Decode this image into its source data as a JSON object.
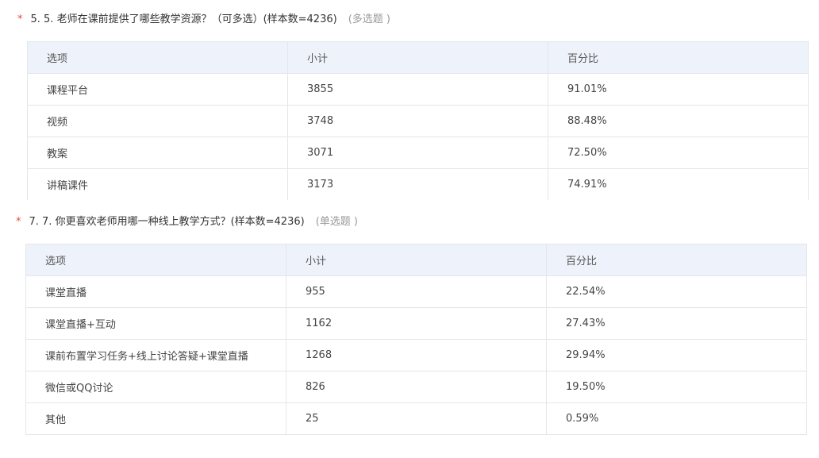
{
  "questions": [
    {
      "required_mark": "*",
      "title": "5. 5. 老师在课前提供了哪些教学资源？（可多选）(样本数=4236)",
      "type_label": "(多选题 )",
      "columns": [
        "选项",
        "小计",
        "百分比"
      ],
      "rows": [
        {
          "option": "课程平台",
          "count": "3855",
          "percent": "91.01%"
        },
        {
          "option": "视频",
          "count": "3748",
          "percent": "88.48%"
        },
        {
          "option": "教案",
          "count": "3071",
          "percent": "72.50%"
        },
        {
          "option": "讲稿课件",
          "count": "3173",
          "percent": "74.91%"
        }
      ]
    },
    {
      "required_mark": "*",
      "title": "7. 7. 你更喜欢老师用哪一种线上教学方式？(样本数=4236)",
      "type_label": "(单选题 )",
      "columns": [
        "选项",
        "小计",
        "百分比"
      ],
      "rows": [
        {
          "option": "课堂直播",
          "count": "955",
          "percent": "22.54%"
        },
        {
          "option": "课堂直播+互动",
          "count": "1162",
          "percent": "27.43%"
        },
        {
          "option": "课前布置学习任务+线上讨论答疑+课堂直播",
          "count": "1268",
          "percent": "29.94%"
        },
        {
          "option": "微信或QQ讨论",
          "count": "826",
          "percent": "19.50%"
        },
        {
          "option": "其他",
          "count": "25",
          "percent": "0.59%"
        }
      ]
    }
  ]
}
